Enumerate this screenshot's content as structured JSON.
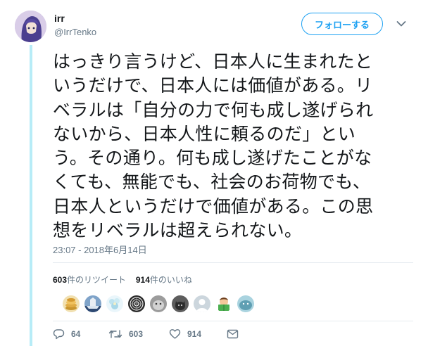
{
  "tweet": {
    "display_name": "irr",
    "handle": "@IrrTenko",
    "follow_label": "フォローする",
    "text_lines": [
      "はっきり言うけど、日本人に生まれたと",
      "いうだけで、日本人には価値がある。リ",
      "ベラルは「自分の力で何も成し遂げられ",
      "ないから、日本人性に頼るのだ」とい",
      "う。その通り。何も成し遂げたことがな",
      "くても、無能でも、社会のお荷物でも、",
      "日本人というだけで価値がある。この思",
      "想をリベラルは超えられない。"
    ],
    "timestamp": "23:07 - 2018年6月14日"
  },
  "stats": {
    "retweets_count": "603",
    "retweets_label": "件のリツイート",
    "likes_count": "914",
    "likes_label": "件のいいね"
  },
  "likers": [
    {
      "name": "coin-stack-avatar",
      "bg": "#e8c26a"
    },
    {
      "name": "ship-avatar",
      "bg": "#3f5f8c"
    },
    {
      "name": "flower-avatar",
      "bg": "#d6ecf5"
    },
    {
      "name": "spiral-avatar",
      "bg": "#303030"
    },
    {
      "name": "blurry-animal-avatar",
      "bg": "#8a8a8a"
    },
    {
      "name": "dog-photo-avatar",
      "bg": "#6e6e6e"
    },
    {
      "name": "default-egg-avatar",
      "bg": "#ccd6dd"
    },
    {
      "name": "reading-emoji-avatar",
      "bg": "#ffffff"
    },
    {
      "name": "teal-animal-avatar",
      "bg": "#7fb4c6"
    }
  ],
  "actions": {
    "reply_count": "64",
    "retweet_count": "603",
    "like_count": "914"
  },
  "colors": {
    "accent": "#1da1f2",
    "secondary_text": "#657786",
    "thread_line": "#b7ecf7"
  },
  "icons": [
    "chevron-down-icon",
    "reply-icon",
    "retweet-icon",
    "like-icon",
    "direct-message-icon"
  ]
}
